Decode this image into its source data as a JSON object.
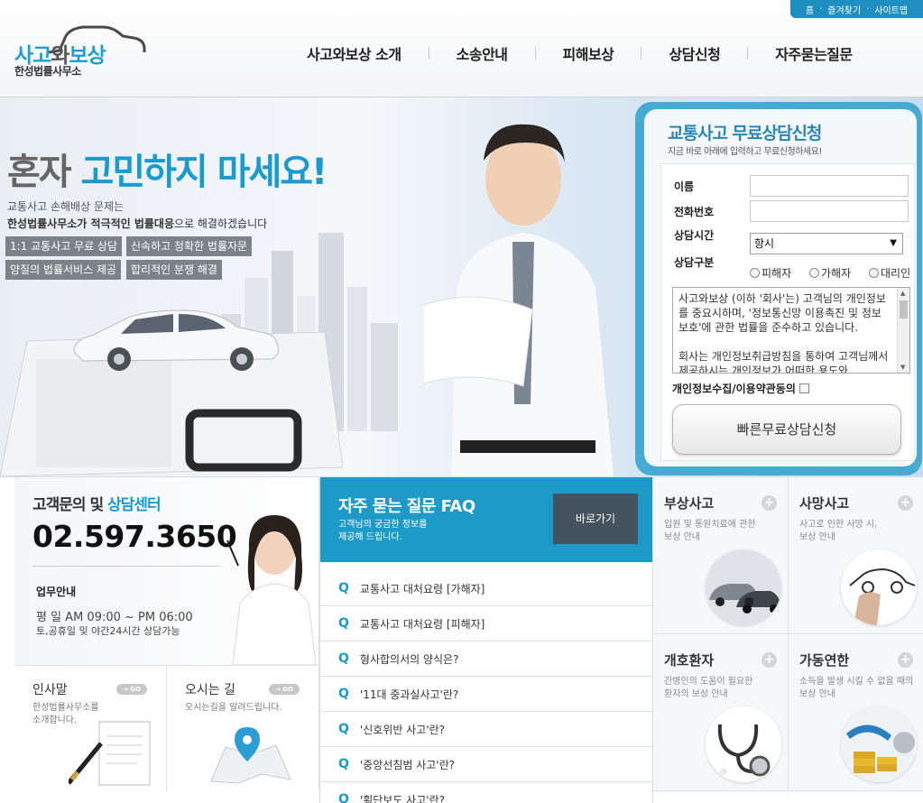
{
  "util": {
    "home": "홈",
    "favorite": "즐겨찾기",
    "sitemap": "사이트맵"
  },
  "logo": {
    "part1": "사고",
    "part2": "와",
    "part3": "보상",
    "sub": "한성법률사무소"
  },
  "nav": [
    "사고와보상 소개",
    "소송안내",
    "피해보상",
    "상담신청",
    "자주묻는질문"
  ],
  "hero": {
    "title_a": "혼자 ",
    "title_b": "고민하지 마세요!",
    "desc1": "교통사고 손해배상 문제는",
    "desc2_bold": "한성법률사무소가 적극적인 법률대응",
    "desc2_rest": "으로 해결하겠습니다",
    "tags": [
      "1:1 교통사고 무료 상담",
      "신속하고 정확한 법률자문",
      "양질의 법률서비스 제공",
      "합리적인 분쟁 해결"
    ]
  },
  "form": {
    "title": "교통사고 무료상담신청",
    "subtitle": "지금 바로 아래에 입력하고 무료신청하세요!",
    "name_label": "이름",
    "phone_label": "전화번호",
    "time_label": "상담시간",
    "time_value": "항시",
    "type_label": "상담구분",
    "types": [
      "피해자",
      "가해자",
      "대리인"
    ],
    "terms": "사고와보상 (이하 '회사'는) 고객님의 개인정보를 중요시하며, '정보통신망 이용촉진 및 정보보호'에 관한 법률을 준수하고 있습니다.\n\n회사는 개인정보취급방침을 통하여 고객님께서 제공하시는 개인정보가 어떠한 용도와",
    "agree_label": "개인정보수집/이용약관동의",
    "submit": "빠른무료상담신청"
  },
  "cs": {
    "title_a": "고객문의 및 ",
    "title_b": "상담센터",
    "phone": "02.597.3650",
    "hours_title": "업무안내",
    "hours1": "평  일 AM 09:00 ~ PM 06:00",
    "hours2": "토,공휴일 및 야간24시간 상담가능"
  },
  "greeting": {
    "title": "인사말",
    "go": "GO",
    "desc": "한성법률사무소를\n소개합니다."
  },
  "location": {
    "title": "오시는 길",
    "go": "GO",
    "desc": "오시는길을 알려드립니다."
  },
  "faq": {
    "title": "자주 묻는 질문  FAQ",
    "desc": "고객님의 궁금한 정보를\n제공해 드립니다.",
    "go": "바로가기",
    "q_mark": "Q",
    "items": [
      "교통사고 대처요령 [가해자]",
      "교통사고 대처요령 [피해자]",
      "형사합의서의 양식은?",
      "'11대 중과실사고'란?",
      "'신호위반 사고'란?",
      "'중앙선침범 사고'란?",
      "'횡단보도 사고'란?"
    ]
  },
  "services": [
    {
      "title": "부상사고",
      "desc": "입원 및 통원치료에 관한\n보상 안내",
      "icon": "car-crash-icon"
    },
    {
      "title": "사망사고",
      "desc": "사고로 인한 사망 시,\n보상 안내",
      "icon": "car-sketch-icon"
    },
    {
      "title": "개호환자",
      "desc": "간병인의 도움이 필요한\n환자의 보상 안내",
      "icon": "stethoscope-icon"
    },
    {
      "title": "가동연한",
      "desc": "소득을 발생 시킬 수 없을 때의\n보상 안내",
      "icon": "coins-icon"
    }
  ]
}
